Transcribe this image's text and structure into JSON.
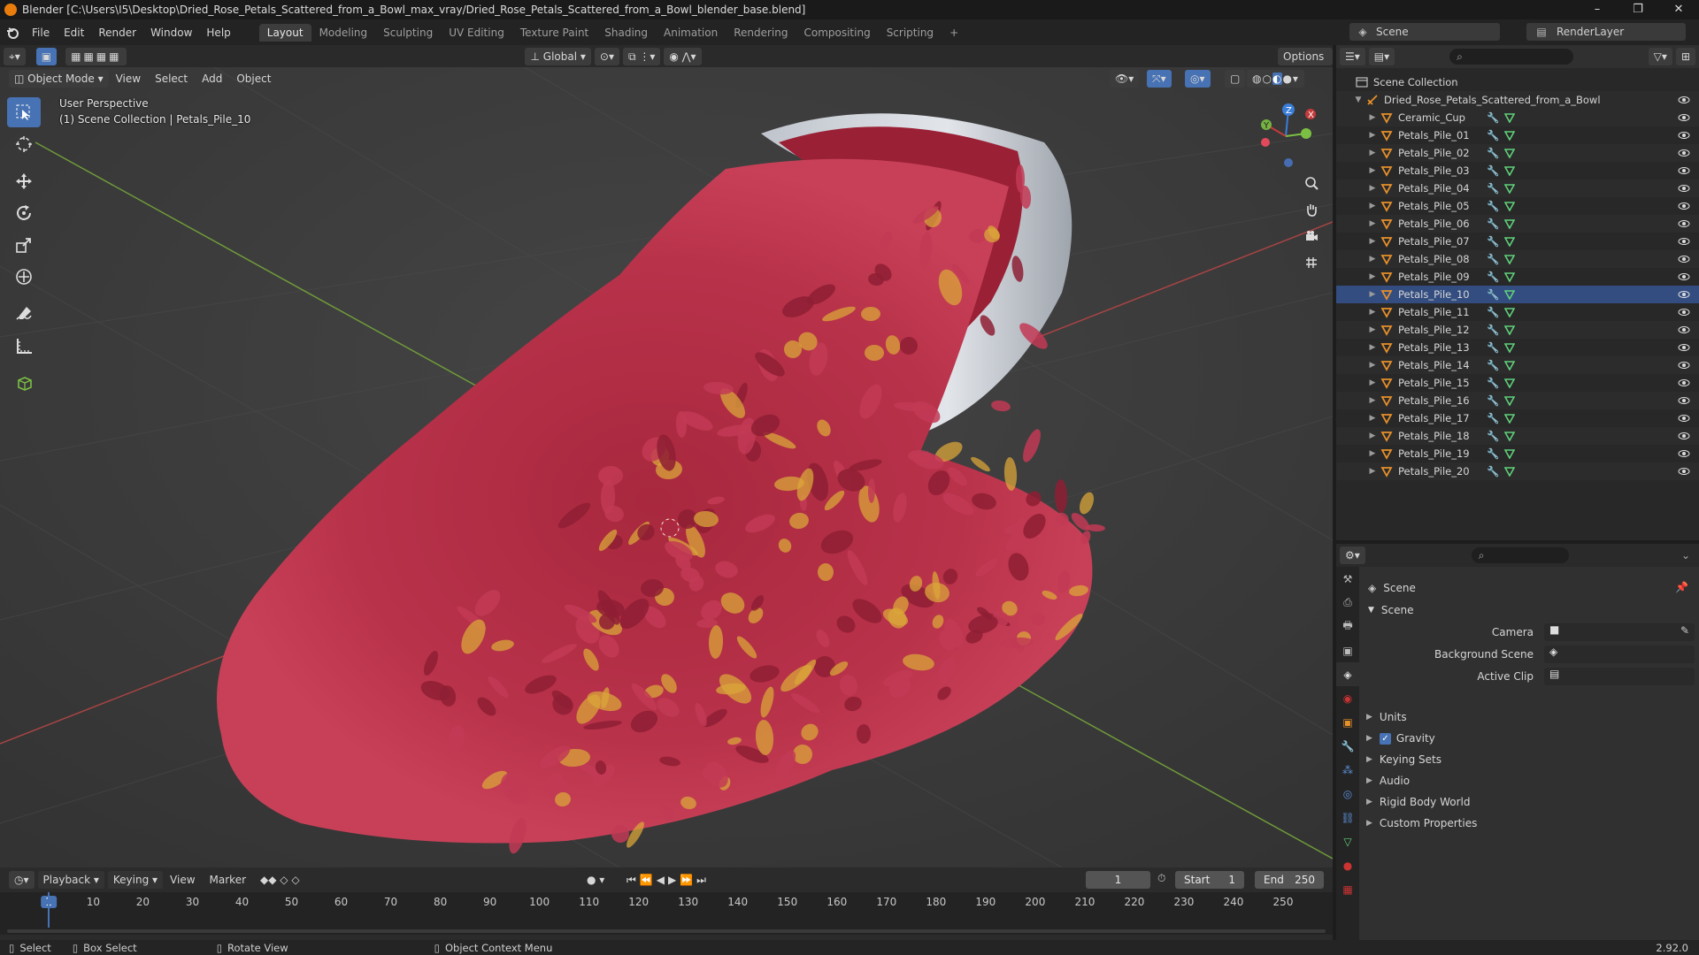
{
  "window": {
    "title": "Blender [C:\\Users\\I5\\Desktop\\Dried_Rose_Petals_Scattered_from_a_Bowl_max_vray/Dried_Rose_Petals_Scattered_from_a_Bowl_blender_base.blend]",
    "controls": [
      "–",
      "❐",
      "✕"
    ]
  },
  "menu": [
    "File",
    "Edit",
    "Render",
    "Window",
    "Help"
  ],
  "workspaces": [
    "Layout",
    "Modeling",
    "Sculpting",
    "UV Editing",
    "Texture Paint",
    "Shading",
    "Animation",
    "Rendering",
    "Compositing",
    "Scripting"
  ],
  "active_workspace": "Layout",
  "scene_selector": {
    "label": "Scene",
    "render_layer": "RenderLayer"
  },
  "tool_header": {
    "orientation": "Global",
    "options": "Options"
  },
  "viewport_header": {
    "mode": "Object Mode",
    "menus": [
      "View",
      "Select",
      "Add",
      "Object"
    ]
  },
  "viewport": {
    "perspective": "User Perspective",
    "context": "(1) Scene Collection | Petals_Pile_10"
  },
  "gizmo": {
    "x": "X",
    "y": "Y",
    "z": "Z"
  },
  "outliner": {
    "root": "Scene Collection",
    "collection": "Dried_Rose_Petals_Scattered_from_a_Bowl",
    "objects": [
      "Ceramic_Cup",
      "Petals_Pile_01",
      "Petals_Pile_02",
      "Petals_Pile_03",
      "Petals_Pile_04",
      "Petals_Pile_05",
      "Petals_Pile_06",
      "Petals_Pile_07",
      "Petals_Pile_08",
      "Petals_Pile_09",
      "Petals_Pile_10",
      "Petals_Pile_11",
      "Petals_Pile_12",
      "Petals_Pile_13",
      "Petals_Pile_14",
      "Petals_Pile_15",
      "Petals_Pile_16",
      "Petals_Pile_17",
      "Petals_Pile_18",
      "Petals_Pile_19",
      "Petals_Pile_20"
    ],
    "selected": "Petals_Pile_10"
  },
  "properties": {
    "context": "Scene",
    "panel": "Scene",
    "fields": [
      {
        "label": "Camera",
        "value": ""
      },
      {
        "label": "Background Scene",
        "value": ""
      },
      {
        "label": "Active Clip",
        "value": ""
      }
    ],
    "sections": [
      "Units",
      "Gravity",
      "Keying Sets",
      "Audio",
      "Rigid Body World",
      "Custom Properties"
    ],
    "gravity_checked": true
  },
  "timeline": {
    "menus": [
      "Playback",
      "Keying",
      "View",
      "Marker"
    ],
    "current_frame": "1",
    "start_label": "Start",
    "start": "1",
    "end_label": "End",
    "end": "250",
    "ticks": [
      "1",
      "10",
      "20",
      "30",
      "40",
      "50",
      "60",
      "70",
      "80",
      "90",
      "100",
      "110",
      "120",
      "130",
      "140",
      "150",
      "160",
      "170",
      "180",
      "190",
      "200",
      "210",
      "220",
      "230",
      "240",
      "250"
    ]
  },
  "statusbar": {
    "items": [
      "Select",
      "Box Select",
      "Rotate View",
      "Object Context Menu"
    ],
    "version": "2.92.0"
  },
  "colors": {
    "accent": "#4772b3",
    "object_orange": "#e8902a",
    "mesh_green": "#5fd07a",
    "petal_red": "#b8324a",
    "petal_gold": "#d9a63a",
    "grid_green": "#6f9a3a",
    "grid_red": "#a84444"
  }
}
